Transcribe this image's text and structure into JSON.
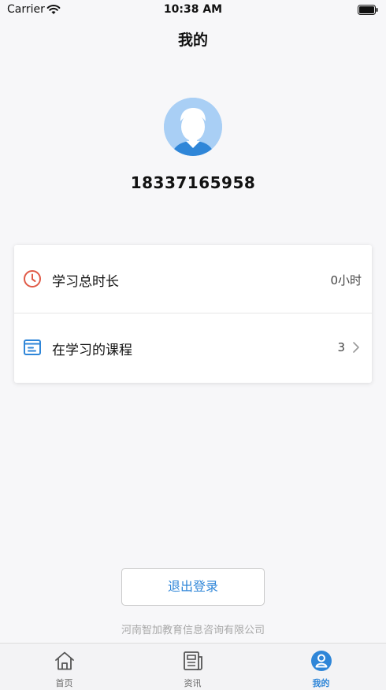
{
  "status_bar": {
    "carrier": "Carrier",
    "time": "10:38 AM"
  },
  "header": {
    "title": "我的"
  },
  "profile": {
    "username": "18337165958",
    "avatar_icon": "user-avatar-icon"
  },
  "stats": {
    "study_time": {
      "label": "学习总时长",
      "value": "0小时",
      "icon": "clock-icon"
    },
    "courses": {
      "label": "在学习的课程",
      "value": "3",
      "icon": "course-list-icon"
    }
  },
  "logout_label": "退出登录",
  "company": "河南智加教育信息咨询有限公司",
  "tabs": [
    {
      "label": "首页",
      "icon": "home-icon",
      "active": false
    },
    {
      "label": "资讯",
      "icon": "news-icon",
      "active": false
    },
    {
      "label": "我的",
      "icon": "profile-icon",
      "active": true
    }
  ],
  "colors": {
    "accent": "#2f86d8",
    "clock_icon": "#e05a47",
    "avatar_bg": "#a9cff5"
  }
}
